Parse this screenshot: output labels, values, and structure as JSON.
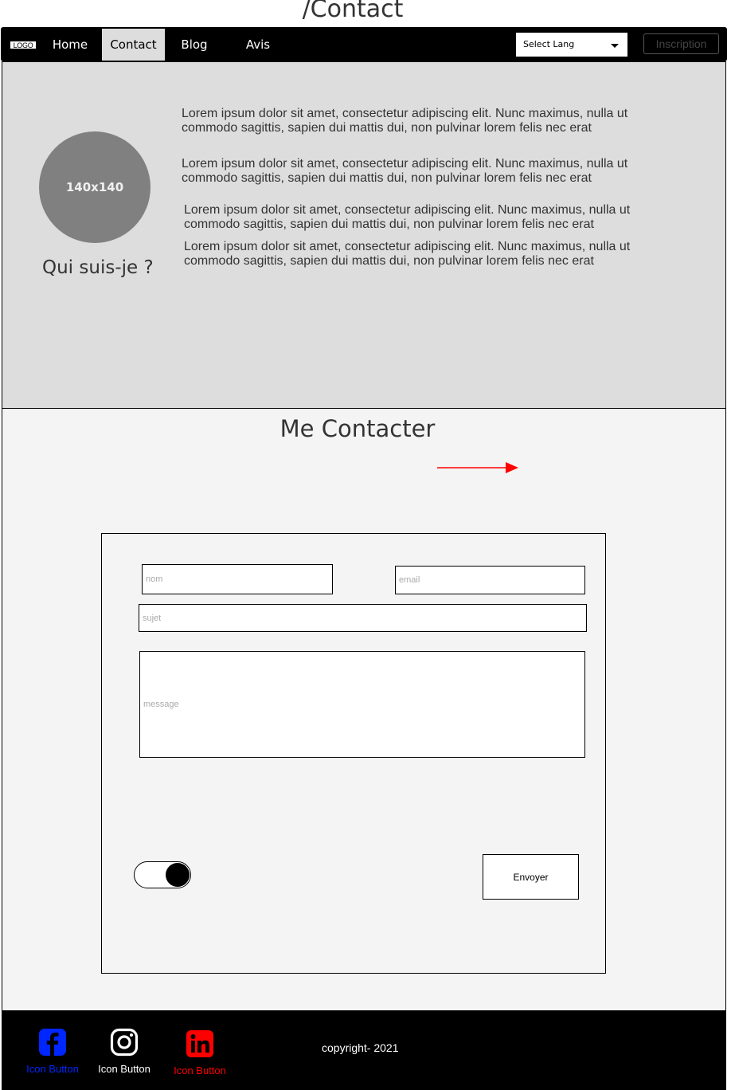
{
  "page_title": "/Contact",
  "navbar": {
    "logo": "LOGO",
    "items": [
      {
        "label": "Home",
        "active": false
      },
      {
        "label": "Contact",
        "active": true
      },
      {
        "label": "Blog",
        "active": false
      },
      {
        "label": "Avis",
        "active": false
      }
    ],
    "language_select": "Select Lang",
    "signup_button": "Inscription"
  },
  "about": {
    "avatar_placeholder": "140x140",
    "heading": "Qui suis-je ?",
    "paragraphs": [
      "Lorem ipsum dolor sit amet, consectetur adipiscing elit. Nunc maximus, nulla ut commodo sagittis, sapien dui mattis dui, non pulvinar lorem felis nec erat",
      "Lorem ipsum dolor sit amet, consectetur adipiscing elit. Nunc maximus, nulla ut commodo sagittis, sapien dui mattis dui, non pulvinar lorem felis nec erat",
      "Lorem ipsum dolor sit amet, consectetur adipiscing elit. Nunc maximus, nulla ut commodo sagittis, sapien dui mattis dui, non pulvinar lorem felis nec erat",
      "Lorem ipsum dolor sit amet, consectetur adipiscing elit. Nunc maximus, nulla ut commodo sagittis, sapien dui mattis dui, non pulvinar lorem felis nec erat"
    ]
  },
  "contact": {
    "title": "Me Contacter",
    "form": {
      "name_placeholder": "nom",
      "email_placeholder": "email",
      "subject_placeholder": "sujet",
      "message_placeholder": "message",
      "toggle_on": true,
      "submit_label": "Envoyer"
    }
  },
  "footer": {
    "social": [
      {
        "icon": "facebook-icon",
        "label": "Icon Button",
        "color": "#0026ff"
      },
      {
        "icon": "instagram-icon",
        "label": "Icon Button",
        "color": "#ffffff"
      },
      {
        "icon": "linkedin-icon",
        "label": "Icon Button",
        "color": "#ff0000"
      }
    ],
    "copyright": "copyright- 2021"
  },
  "colors": {
    "navbar_bg": "#000000",
    "active_tab_bg": "#dddddd",
    "about_bg": "#dddddd",
    "contact_bg": "#f4f4f4",
    "arrow": "#ff0000"
  }
}
